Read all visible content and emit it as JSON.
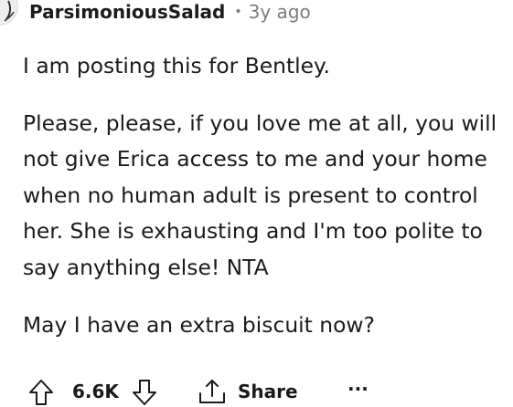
{
  "comment": {
    "author": "ParsimoniousSalad",
    "separator": "•",
    "timestamp": "3y ago",
    "paragraphs": [
      "I am posting this for Bentley.",
      "Please, please, if you love me at all, you will not give Erica access to me and your home when no human adult is present to control her. She is exhausting and I'm too polite to say anything else! NTA",
      "May I have an extra biscuit now?"
    ]
  },
  "actions": {
    "upvote_icon": "upvote-arrow-icon",
    "score": "6.6K",
    "downvote_icon": "downvote-arrow-icon",
    "share_icon": "share-icon",
    "share_label": "Share",
    "more_label": "···"
  },
  "colors": {
    "text": "#1a1a1b",
    "meta": "#7c7c7c",
    "background": "#ffffff"
  }
}
